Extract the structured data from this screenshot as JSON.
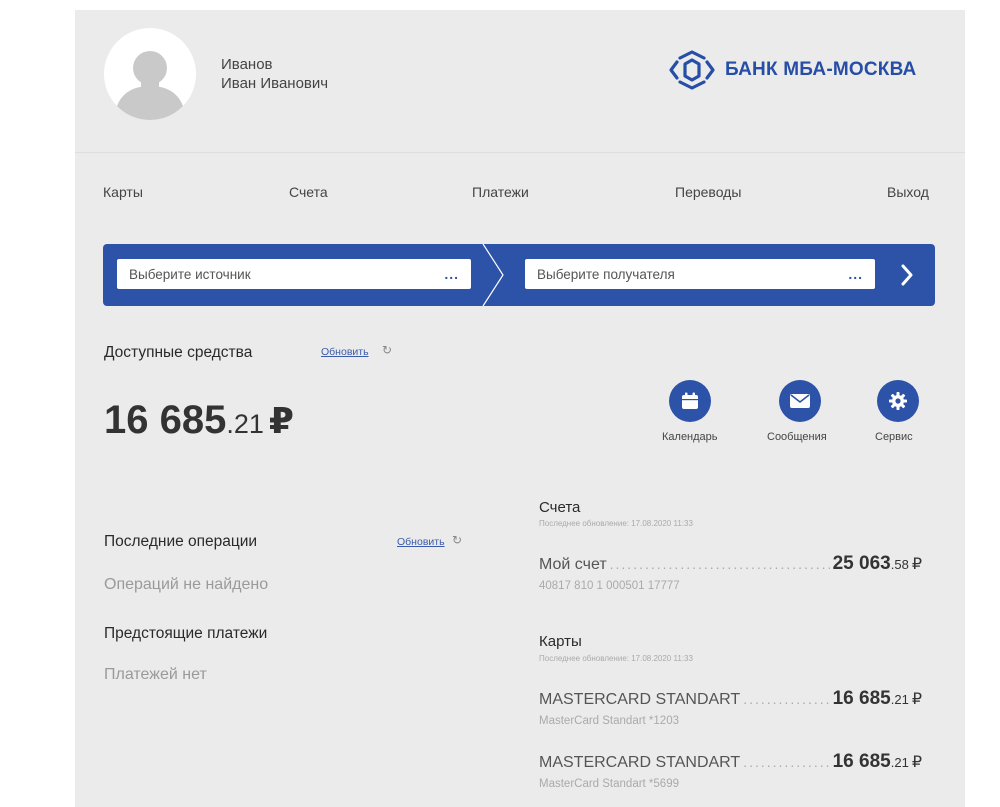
{
  "user": {
    "last_name": "Иванов",
    "first_name": "Иван Иванович"
  },
  "brand": {
    "name": "БАНК МБА-МОСКВА",
    "color": "#2c53a8"
  },
  "nav": {
    "cards": "Карты",
    "accounts": "Счета",
    "payments": "Платежи",
    "transfers": "Переводы",
    "logout": "Выход"
  },
  "transfer": {
    "source_placeholder": "Выберите источник",
    "dest_placeholder": "Выберите получателя",
    "more": "..."
  },
  "funds": {
    "label": "Доступные средства",
    "refresh": "Обновить",
    "balance_int": "16 685",
    "balance_frac": ".21",
    "currency": "₽"
  },
  "quick_actions": {
    "calendar": "Календарь",
    "messages": "Сообщения",
    "service": "Сервис"
  },
  "recent": {
    "title": "Последние операции",
    "refresh": "Обновить",
    "empty": "Операций не найдено"
  },
  "upcoming": {
    "title": "Предстоящие платежи",
    "empty": "Платежей нет"
  },
  "accounts": {
    "title": "Счета",
    "updated": "Последнее обновление: 17.08.2020 11:33",
    "items": [
      {
        "name": "Мой счет",
        "amount_int": "25 063",
        "amount_frac": ".58",
        "currency": "₽",
        "sub": "40817 810 1 000501 17777"
      }
    ]
  },
  "cards": {
    "title": "Карты",
    "updated": "Последнее обновление: 17.08.2020 11:33",
    "items": [
      {
        "name": "MASTERCARD STANDART",
        "amount_int": "16 685",
        "amount_frac": ".21",
        "currency": "₽",
        "sub": "MasterCard Standart *1203"
      },
      {
        "name": "MASTERCARD STANDART",
        "amount_int": "16 685",
        "amount_frac": ".21",
        "currency": "₽",
        "sub": "MasterCard Standart *5699"
      }
    ]
  }
}
